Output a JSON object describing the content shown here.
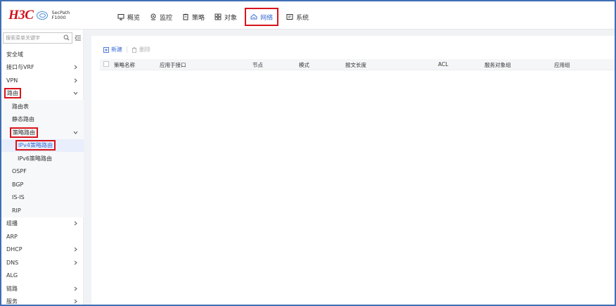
{
  "brand": {
    "logo": "H3C",
    "product_line1": "SecPath",
    "product_line2": "F1000"
  },
  "nav": [
    {
      "label": "概览",
      "icon": "monitor-icon"
    },
    {
      "label": "监控",
      "icon": "location-pin-icon"
    },
    {
      "label": "策略",
      "icon": "clipboard-icon"
    },
    {
      "label": "对象",
      "icon": "grid-icon"
    },
    {
      "label": "网络",
      "icon": "network-icon",
      "active": true
    },
    {
      "label": "系统",
      "icon": "system-icon"
    }
  ],
  "sidebar": {
    "search_placeholder": "搜索菜单关键字",
    "items": [
      {
        "label": "安全域"
      },
      {
        "label": "接口与VRF"
      },
      {
        "label": "VPN"
      },
      {
        "label": "路由"
      },
      {
        "label": "路由表"
      },
      {
        "label": "静态路由"
      },
      {
        "label": "策略路由"
      },
      {
        "label": "IPv4策略路由"
      },
      {
        "label": "IPv6策略路由"
      },
      {
        "label": "OSPF"
      },
      {
        "label": "BGP"
      },
      {
        "label": "IS-IS"
      },
      {
        "label": "RIP"
      },
      {
        "label": "组播"
      },
      {
        "label": "ARP"
      },
      {
        "label": "DHCP"
      },
      {
        "label": "DNS"
      },
      {
        "label": "ALG"
      },
      {
        "label": "链路"
      },
      {
        "label": "服务"
      }
    ]
  },
  "toolbar": {
    "new_label": "新建",
    "delete_label": "删除"
  },
  "table": {
    "columns": [
      "策略名称",
      "应用于接口",
      "节点",
      "模式",
      "报文长度",
      "ACL",
      "服务对象组",
      "应用组"
    ]
  },
  "colors": {
    "accent": "#3b6cd6",
    "highlight_border": "#d9141c",
    "frame_border": "#3f6fb5"
  }
}
